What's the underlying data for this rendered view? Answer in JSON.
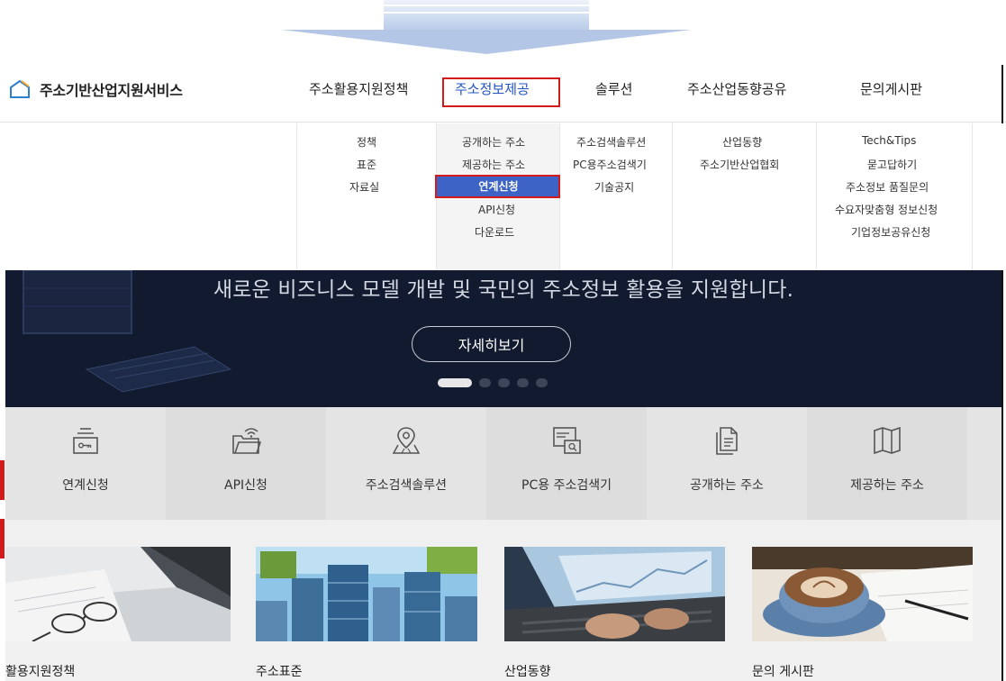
{
  "site": {
    "title": "주소기반산업지원서비스"
  },
  "gnb": [
    {
      "label": "주소활용지원정책"
    },
    {
      "label": "주소정보제공"
    },
    {
      "label": "솔루션"
    },
    {
      "label": "주소산업동향공유"
    },
    {
      "label": "문의게시판"
    }
  ],
  "gnb_active": "주소정보제공",
  "dropdown": {
    "policy": [
      "정책",
      "표준",
      "자료실"
    ],
    "provision": [
      "공개하는 주소",
      "제공하는 주소",
      "연계신청",
      "API신청",
      "다운로드"
    ],
    "solution": [
      "주소검색솔루션",
      "PC용주소검색기",
      "기술공지"
    ],
    "industry": [
      "산업동향",
      "주소기반산업협회"
    ],
    "board": [
      "Tech&Tips",
      "묻고답하기",
      "주소정보 품질문의",
      "수요자맞춤형 정보신청",
      "기업정보공유신청"
    ]
  },
  "dropdown_selected": "연계신청",
  "hero": {
    "title": "새로운 비즈니스 모델 개발 및 국민의 주소정보 활용을 지원합니다.",
    "button": "자세히보기",
    "slide_count": 5,
    "active_slide": 1
  },
  "quick_menu": [
    {
      "label": "연계신청",
      "icon": "folder-key-icon"
    },
    {
      "label": "API신청",
      "icon": "folder-wifi-icon"
    },
    {
      "label": "주소검색솔루션",
      "icon": "map-pin-icon"
    },
    {
      "label": "PC용 주소검색기",
      "icon": "pc-search-icon"
    },
    {
      "label": "공개하는 주소",
      "icon": "document-icon"
    },
    {
      "label": "제공하는 주소",
      "icon": "book-map-icon"
    }
  ],
  "cards": [
    {
      "title": "활용지원정책",
      "image": "laptop-glasses-photo"
    },
    {
      "title": "주소표준",
      "image": "city-buildings-photo"
    },
    {
      "title": "산업동향",
      "image": "laptop-typing-photo"
    },
    {
      "title": "문의 게시판",
      "image": "coffee-cup-photo"
    }
  ],
  "colors": {
    "accent": "#3c63c5",
    "highlight_box": "#d31a1a",
    "hero_bg": "#111a2e",
    "quick_bg": "#e4e4e4"
  }
}
